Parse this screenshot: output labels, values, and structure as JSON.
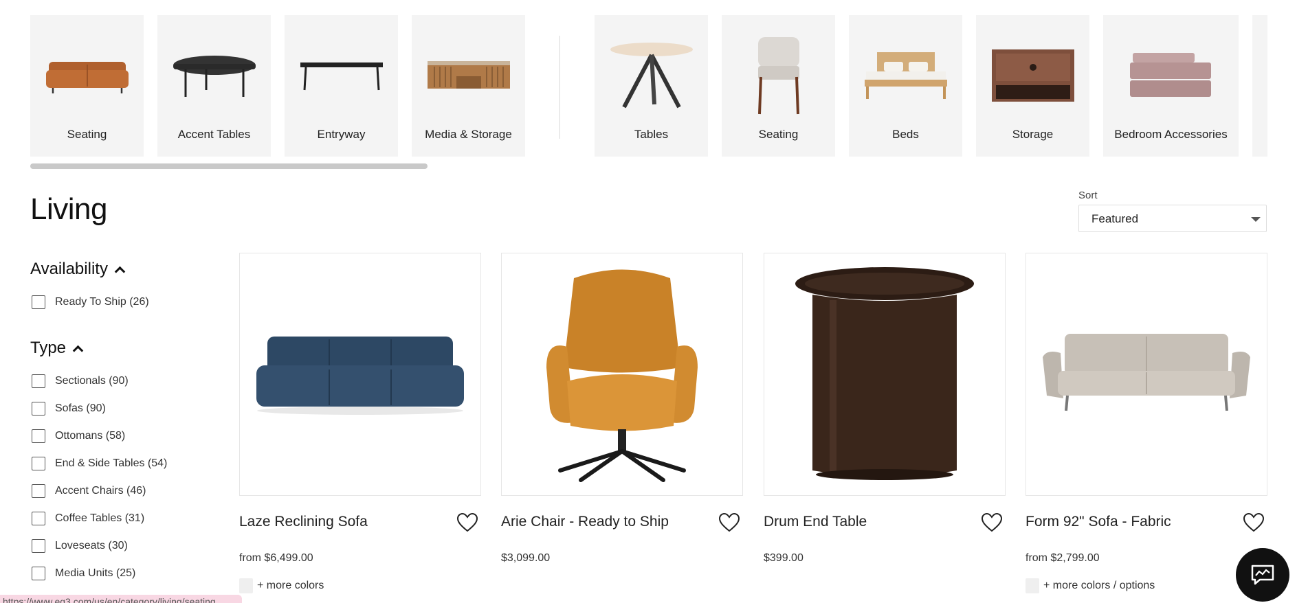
{
  "categories_left": [
    {
      "label": "Seating",
      "icon": "sofa-thumbnail"
    },
    {
      "label": "Accent Tables",
      "icon": "accent-table-thumbnail"
    },
    {
      "label": "Entryway",
      "icon": "bench-thumbnail"
    },
    {
      "label": "Media & Storage",
      "icon": "media-console-thumbnail"
    }
  ],
  "categories_right": [
    {
      "label": "Tables",
      "icon": "round-table-thumbnail"
    },
    {
      "label": "Seating",
      "icon": "dining-chair-thumbnail"
    },
    {
      "label": "Beds",
      "icon": "bed-thumbnail"
    },
    {
      "label": "Storage",
      "icon": "nightstand-thumbnail"
    },
    {
      "label": "Bedroom Accessories",
      "icon": "linens-thumbnail"
    }
  ],
  "page": {
    "title": "Living"
  },
  "sort": {
    "label": "Sort",
    "selected": "Featured"
  },
  "filters": {
    "availability": {
      "title": "Availability",
      "options": [
        {
          "label": "Ready To Ship (26)"
        }
      ]
    },
    "type": {
      "title": "Type",
      "options": [
        {
          "label": "Sectionals (90)"
        },
        {
          "label": "Sofas (90)"
        },
        {
          "label": "Ottomans (58)"
        },
        {
          "label": "End & Side Tables (54)"
        },
        {
          "label": "Accent Chairs (46)"
        },
        {
          "label": "Coffee Tables (31)"
        },
        {
          "label": "Loveseats (30)"
        },
        {
          "label": "Media Units (25)"
        }
      ]
    }
  },
  "products": [
    {
      "name": "Laze Reclining Sofa",
      "price": "from $6,499.00",
      "more": "+ more colors",
      "color": "#2f4a66"
    },
    {
      "name": "Arie Chair - Ready to Ship",
      "price": "$3,099.00",
      "more": "",
      "color": "#d08a2e"
    },
    {
      "name": "Drum End Table",
      "price": "$399.00",
      "more": "",
      "color": "#3b271d"
    },
    {
      "name": "Form 92\" Sofa - Fabric",
      "price": "from $2,799.00",
      "more": "+ more colors / options",
      "color": "#c9c3bb"
    }
  ],
  "status_url": "https://www.eq3.com/us/en/category/living/seating",
  "colors": {
    "tile_bg": "#f4f4f4",
    "chat_bg": "#111111"
  }
}
